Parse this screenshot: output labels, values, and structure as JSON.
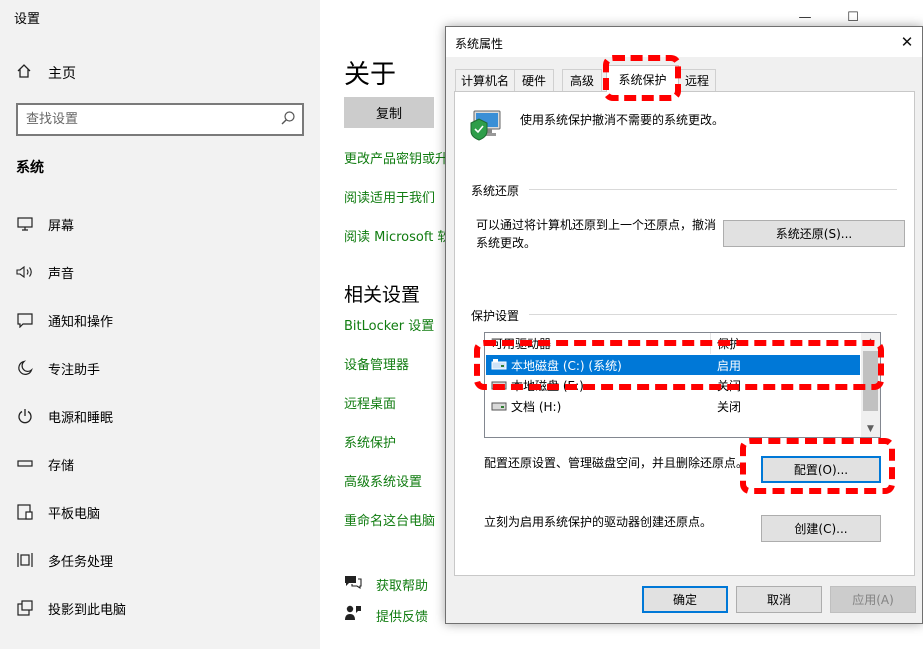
{
  "settings": {
    "app_title": "设置",
    "home_label": "主页",
    "search_placeholder": "查找设置",
    "section": "系统",
    "nav": [
      {
        "icon": "monitor-icon",
        "label": "屏幕"
      },
      {
        "icon": "speaker-icon",
        "label": "声音"
      },
      {
        "icon": "notification-icon",
        "label": "通知和操作"
      },
      {
        "icon": "moon-icon",
        "label": "专注助手"
      },
      {
        "icon": "power-icon",
        "label": "电源和睡眠"
      },
      {
        "icon": "storage-icon",
        "label": "存储"
      },
      {
        "icon": "tablet-icon",
        "label": "平板电脑"
      },
      {
        "icon": "multitasking-icon",
        "label": "多任务处理"
      },
      {
        "icon": "project-icon",
        "label": "投影到此电脑"
      }
    ],
    "main": {
      "title": "关于",
      "copy_button": "复制",
      "links": [
        "更改产品密钥或升",
        "阅读适用于我们",
        "阅读 Microsoft 软"
      ],
      "related_title": "相关设置",
      "related_links": [
        "BitLocker 设置",
        "设备管理器",
        "远程桌面",
        "系统保护",
        "高级系统设置",
        "重命名这台电脑"
      ],
      "help": [
        {
          "icon": "help-icon",
          "label": "获取帮助"
        },
        {
          "icon": "feedback-icon",
          "label": "提供反馈"
        }
      ]
    }
  },
  "dialog": {
    "title": "系统属性",
    "tabs": [
      "计算机名",
      "硬件",
      "高级",
      "系统保护",
      "远程"
    ],
    "active_tab": "系统保护",
    "intro": "使用系统保护撤消不需要的系统更改。",
    "restore_group": "系统还原",
    "restore_text": "可以通过将计算机还原到上一个还原点，撤消系统更改。",
    "restore_button": "系统还原(S)...",
    "protection_group": "保护设置",
    "list_headers": [
      "可用驱动器",
      "保护"
    ],
    "drives": [
      {
        "name": "本地磁盘 (C:) (系统)",
        "status": "启用",
        "selected": true
      },
      {
        "name": "本地磁盘 (E:)",
        "status": "关闭",
        "selected": false
      },
      {
        "name": "文档 (H:)",
        "status": "关闭",
        "selected": false
      }
    ],
    "configure_text": "配置还原设置、管理磁盘空间，并且删除还原点。",
    "configure_button": "配置(O)...",
    "create_text": "立刻为启用系统保护的驱动器创建还原点。",
    "create_button": "创建(C)...",
    "ok_button": "确定",
    "cancel_button": "取消",
    "apply_button": "应用(A)"
  },
  "colors": {
    "accent": "#0078d7",
    "link": "#107c10",
    "annotation": "#ff0000"
  }
}
